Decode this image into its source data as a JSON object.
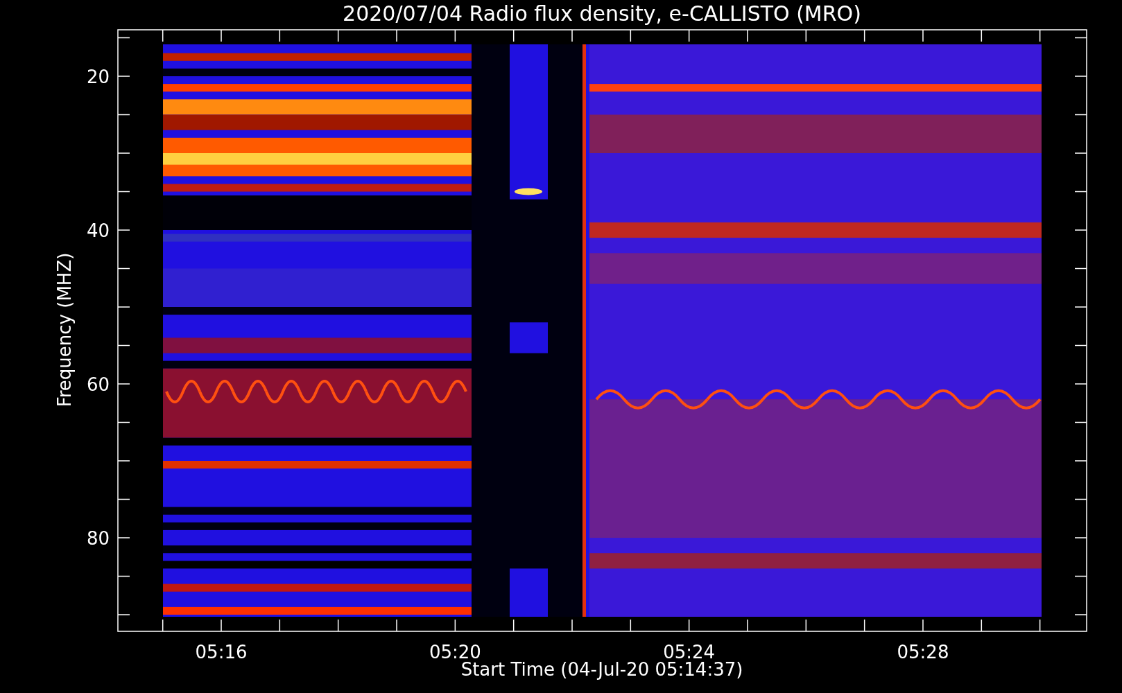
{
  "title": "2020/07/04  Radio flux density, e-CALLISTO (MRO)",
  "ylabel": "Frequency (MHZ)",
  "xlabel": "Start Time (04-Jul-20 05:14:37)",
  "yticks": [
    "20",
    "40",
    "60",
    "80"
  ],
  "xticks": [
    "05:16",
    "05:20",
    "05:24",
    "05:28"
  ]
}
